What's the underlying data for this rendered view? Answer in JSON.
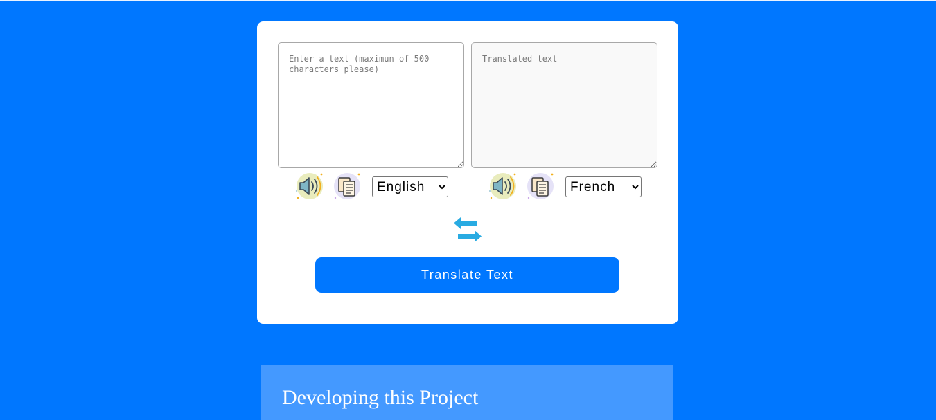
{
  "translator": {
    "source": {
      "placeholder": "Enter a text (maximun of 500 characters please)",
      "value": "",
      "speak_icon": "speaker-icon",
      "copy_icon": "copy-icon",
      "language": "English",
      "language_options": [
        "English",
        "French"
      ]
    },
    "target": {
      "placeholder": "Translated text",
      "value": "",
      "speak_icon": "speaker-icon",
      "copy_icon": "copy-icon",
      "language": "French",
      "language_options": [
        "French",
        "English"
      ]
    },
    "swap_icon": "swap-arrows-icon",
    "translate_button_label": "Translate Text"
  },
  "about": {
    "heading": "Developing this Project"
  },
  "colors": {
    "page_background": "#0077ff",
    "button": "#0077ff",
    "about_panel": "#4499ff",
    "swap_icon": "#29abe2"
  }
}
